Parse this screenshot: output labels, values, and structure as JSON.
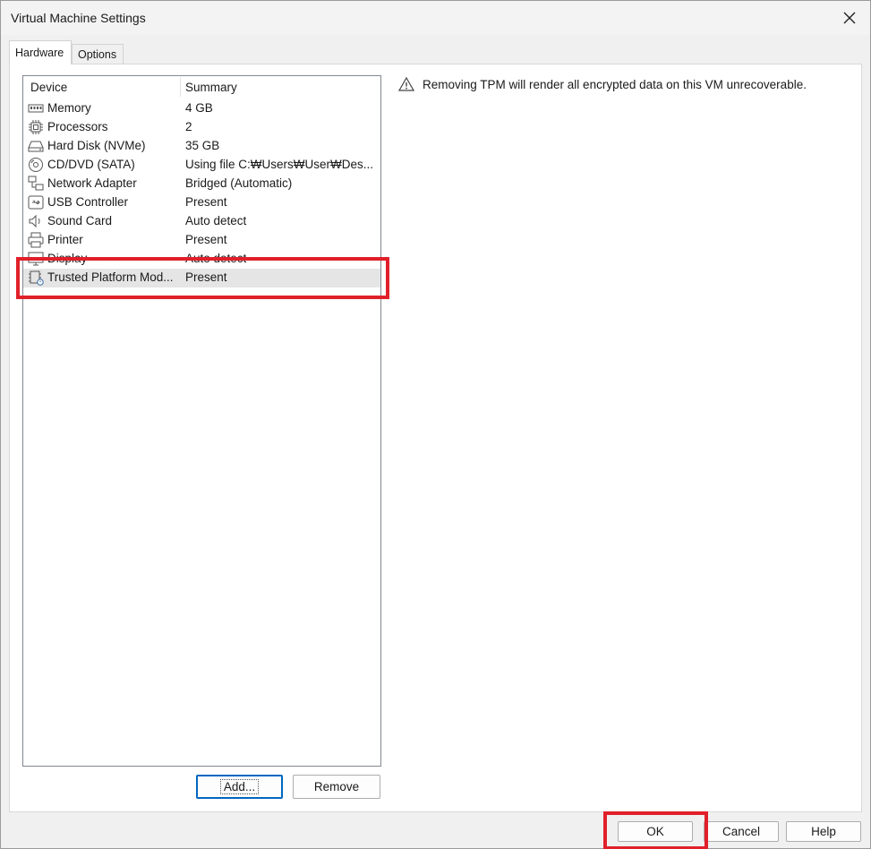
{
  "window": {
    "title": "Virtual Machine Settings"
  },
  "tabs": [
    {
      "label": "Hardware",
      "active": true
    },
    {
      "label": "Options",
      "active": false
    }
  ],
  "device_list": {
    "columns": [
      "Device",
      "Summary"
    ],
    "rows": [
      {
        "icon": "memory-icon",
        "device": "Memory",
        "summary": "4 GB"
      },
      {
        "icon": "processor-icon",
        "device": "Processors",
        "summary": "2"
      },
      {
        "icon": "hard-disk-icon",
        "device": "Hard Disk (NVMe)",
        "summary": "35 GB"
      },
      {
        "icon": "cd-dvd-icon",
        "device": "CD/DVD (SATA)",
        "summary": "Using file C:₩Users₩User₩Des..."
      },
      {
        "icon": "network-icon",
        "device": "Network Adapter",
        "summary": "Bridged (Automatic)"
      },
      {
        "icon": "usb-icon",
        "device": "USB Controller",
        "summary": "Present"
      },
      {
        "icon": "speaker-icon",
        "device": "Sound Card",
        "summary": "Auto detect"
      },
      {
        "icon": "printer-icon",
        "device": "Printer",
        "summary": "Present"
      },
      {
        "icon": "display-icon",
        "device": "Display",
        "summary": "Auto detect"
      },
      {
        "icon": "tpm-icon",
        "device": "Trusted Platform Mod...",
        "summary": "Present",
        "selected": true
      }
    ]
  },
  "warning": {
    "icon": "warning-icon",
    "text": "Removing TPM will render all encrypted data on this VM unrecoverable."
  },
  "buttons": {
    "add": "Add...",
    "remove": "Remove",
    "ok": "OK",
    "cancel": "Cancel",
    "help": "Help"
  },
  "colors": {
    "highlight": "#e0202a",
    "selection": "#e5e5e5",
    "default_button_border": "#0067c0"
  }
}
